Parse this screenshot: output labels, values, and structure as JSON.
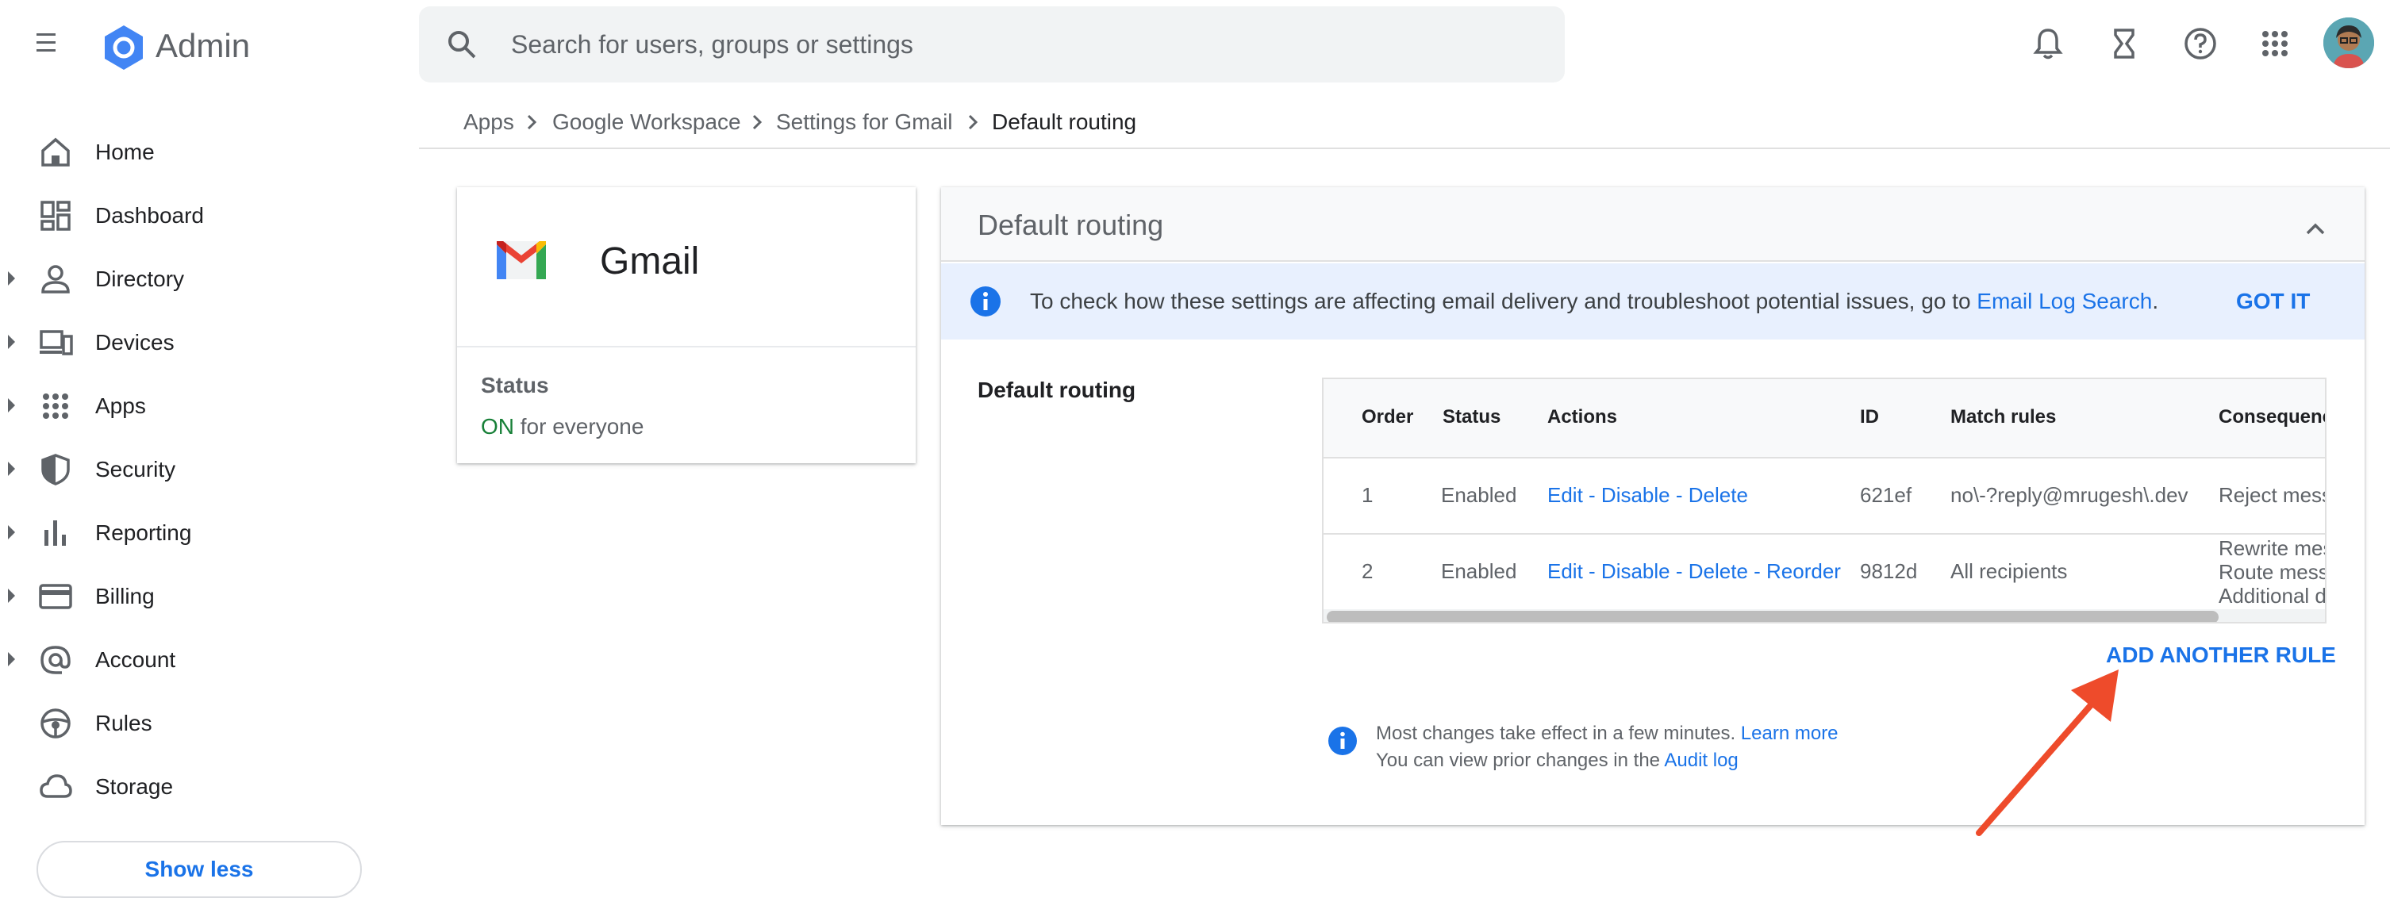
{
  "header": {
    "brand": "Admin",
    "search_placeholder": "Search for users, groups or settings",
    "icons": [
      "menu-icon",
      "admin-logo-icon",
      "search-icon",
      "notifications-icon",
      "tasks-hourglass-icon",
      "help-icon",
      "apps-grid-icon",
      "avatar"
    ]
  },
  "sidebar": {
    "items": [
      {
        "label": "Home",
        "icon": "home-icon",
        "expandable": false
      },
      {
        "label": "Dashboard",
        "icon": "dashboard-icon",
        "expandable": false
      },
      {
        "label": "Directory",
        "icon": "person-icon",
        "expandable": true
      },
      {
        "label": "Devices",
        "icon": "devices-icon",
        "expandable": true
      },
      {
        "label": "Apps",
        "icon": "apps-icon",
        "expandable": true
      },
      {
        "label": "Security",
        "icon": "shield-icon",
        "expandable": true
      },
      {
        "label": "Reporting",
        "icon": "bar-chart-icon",
        "expandable": true
      },
      {
        "label": "Billing",
        "icon": "credit-card-icon",
        "expandable": true
      },
      {
        "label": "Account",
        "icon": "at-sign-icon",
        "expandable": true
      },
      {
        "label": "Rules",
        "icon": "steering-wheel-icon",
        "expandable": false
      },
      {
        "label": "Storage",
        "icon": "cloud-icon",
        "expandable": false
      }
    ],
    "show_less": "Show less"
  },
  "breadcrumb": {
    "items": [
      "Apps",
      "Google Workspace",
      "Settings for Gmail",
      "Default routing"
    ]
  },
  "app_card": {
    "title": "Gmail",
    "status_label": "Status",
    "status_on": "ON",
    "status_rest": " for everyone"
  },
  "panel": {
    "title": "Default routing",
    "info_text": "To check how these settings are affecting email delivery and troubleshoot potential issues, go to ",
    "info_link": "Email Log Search",
    "info_end": ".",
    "got_it": "GOT IT",
    "section_label": "Default routing",
    "table": {
      "headers": [
        "Order",
        "Status",
        "Actions",
        "ID",
        "Match rules",
        "Consequence"
      ],
      "rows": [
        {
          "order": "1",
          "status": "Enabled",
          "actions": [
            "Edit",
            "Disable",
            "Delete"
          ],
          "id": "621ef",
          "match": "no\\-?reply@mrugesh\\.dev",
          "consequence": [
            "Reject mess"
          ]
        },
        {
          "order": "2",
          "status": "Enabled",
          "actions": [
            "Edit",
            "Disable",
            "Delete",
            "Reorder"
          ],
          "id": "9812d",
          "match": "All recipients",
          "consequence": [
            "Rewrite mes",
            "Route mess",
            "Additional d"
          ]
        }
      ],
      "action_separator": " - "
    },
    "add_rule": "ADD ANOTHER RULE",
    "footer_line1": "Most changes take effect in a few minutes. ",
    "footer_link1": "Learn more",
    "footer_line2": "You can view prior changes in the ",
    "footer_link2": "Audit log"
  },
  "colors": {
    "accent": "#1a73e8",
    "status_on": "#188038",
    "info_bg": "#e8f0fe",
    "annotation_arrow": "#ee4b2b"
  }
}
